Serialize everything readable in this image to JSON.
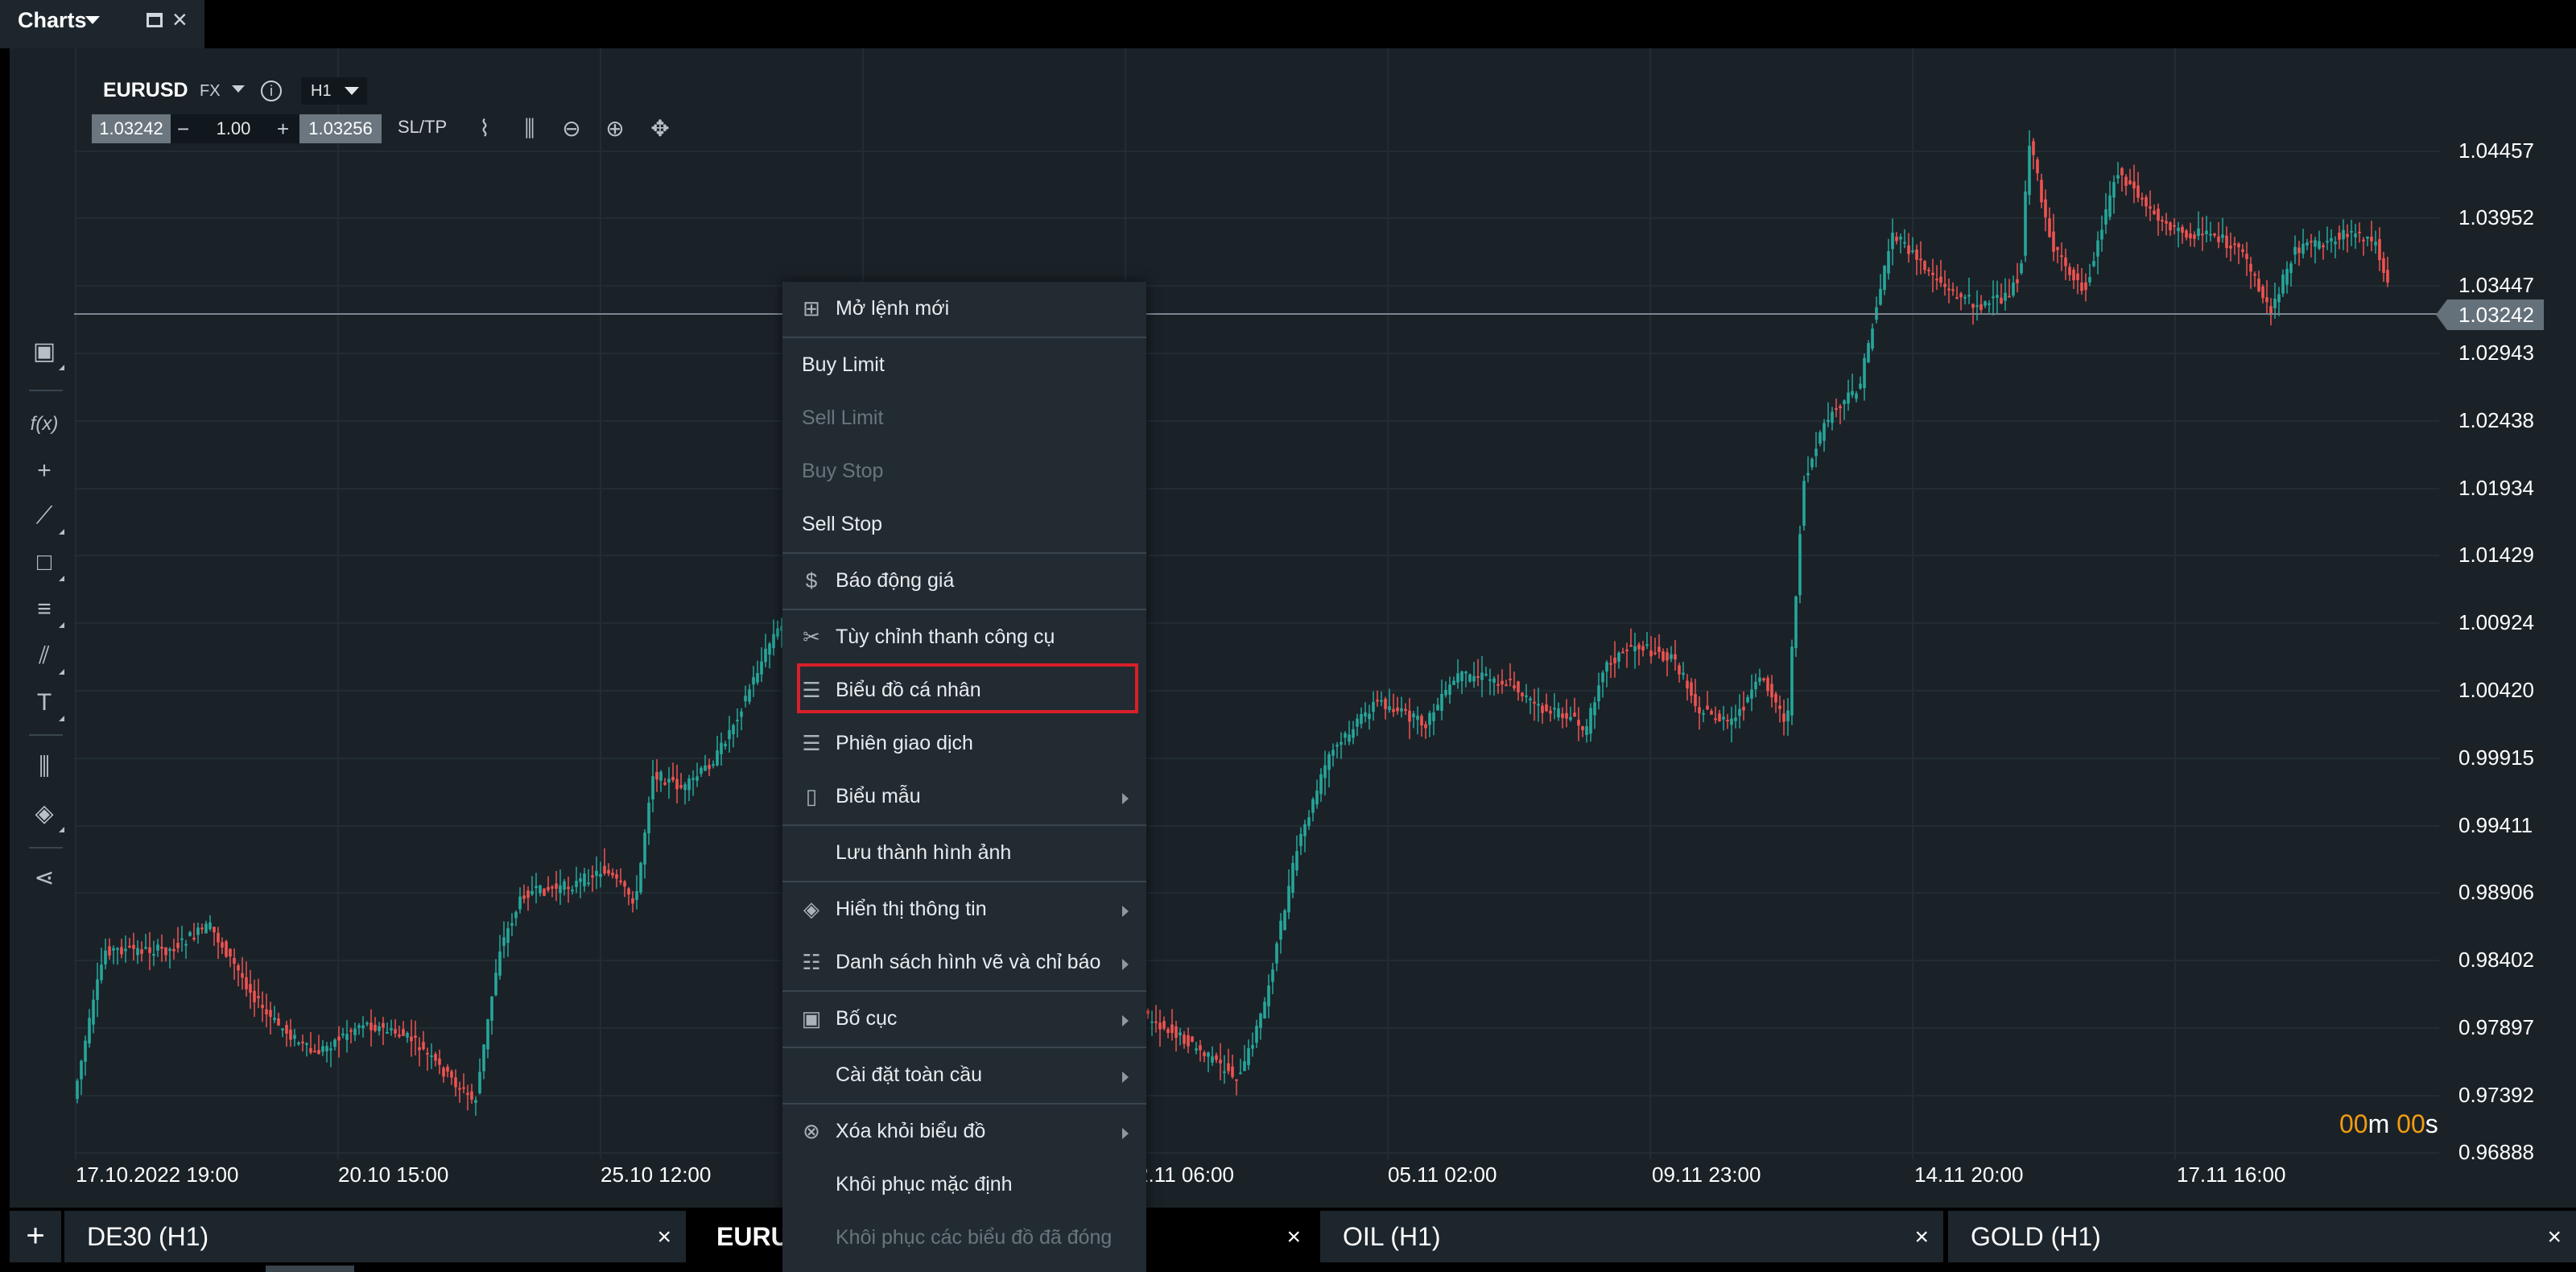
{
  "window": {
    "title": "Charts"
  },
  "symbol": {
    "name": "EURUSD",
    "type": "FX",
    "timeframe": "H1"
  },
  "order_bar": {
    "bid": "1.03242",
    "minus": "−",
    "quantity": "1.00",
    "plus": "+",
    "ask": "1.03256",
    "sltp": "SL/TP"
  },
  "price_axis": {
    "labels": [
      "1.04457",
      "1.03952",
      "1.03447",
      "1.02943",
      "1.02438",
      "1.01934",
      "1.01429",
      "1.00924",
      "1.00420",
      "0.99915",
      "0.99411",
      "0.98906",
      "0.98402",
      "0.97897",
      "0.97392",
      "0.96888"
    ],
    "current_price": "1.03242",
    "range": [
      0.96888,
      1.04457
    ]
  },
  "time_axis": {
    "labels": [
      "17.10.2022 19:00",
      "20.10 15:00",
      "25.10 12:00",
      "",
      "2.11 06:00",
      "05.11 02:00",
      "09.11 23:00",
      "14.11 20:00",
      "17.11 16:00"
    ]
  },
  "countdown": {
    "min": "00",
    "min_unit": "m",
    "sec": "00",
    "sec_unit": "s",
    "color": "#f39c12"
  },
  "context_menu": {
    "items": [
      {
        "label": "Mở lệnh mới",
        "icon": "plus-box-icon"
      },
      {
        "label": "Buy Limit"
      },
      {
        "label": "Sell Limit",
        "disabled": true
      },
      {
        "label": "Buy Stop",
        "disabled": true
      },
      {
        "label": "Sell Stop"
      },
      {
        "label": "Báo động giá",
        "icon": "price-alert-icon"
      },
      {
        "label": "Tùy chỉnh thanh công cụ",
        "icon": "tools-icon"
      },
      {
        "label": "Biểu đồ cá nhân",
        "icon": "sliders-icon"
      },
      {
        "label": "Phiên giao dịch",
        "icon": "sliders-icon"
      },
      {
        "label": "Biểu mẫu",
        "icon": "document-icon",
        "submenu": true
      },
      {
        "label": "Lưu thành hình ảnh"
      },
      {
        "label": "Hiển thị thông tin",
        "icon": "layers-icon",
        "submenu": true
      },
      {
        "label": "Danh sách hình vẽ và chỉ báo",
        "icon": "list-icon",
        "submenu": true
      },
      {
        "label": "Bố cục",
        "icon": "layout-icon",
        "submenu": true
      },
      {
        "label": "Cài đặt toàn cầu",
        "submenu": true
      },
      {
        "label": "Xóa khỏi biểu đồ",
        "icon": "remove-circle-icon",
        "submenu": true
      },
      {
        "label": "Khôi phục mặc định"
      },
      {
        "label": "Khôi phục các biểu đồ đã đóng",
        "disabled": true
      }
    ]
  },
  "bottom_tabs": [
    {
      "label": "DE30 (H1)"
    },
    {
      "label": "EURU",
      "active": true
    },
    {
      "label": "OIL (H1)"
    },
    {
      "label": "GOLD (H1)"
    }
  ],
  "colors": {
    "up_candle": "#26a69a",
    "down_candle": "#ef5350",
    "highlight": "#d8202a",
    "background": "#1a2228"
  }
}
